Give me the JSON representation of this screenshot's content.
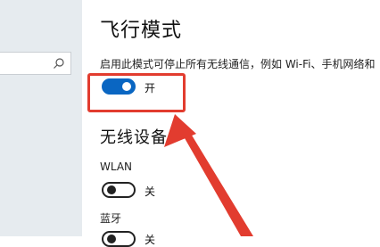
{
  "sidebar": {
    "search": {
      "placeholder": "",
      "icon": "search-icon"
    }
  },
  "main": {
    "title": "飞行模式",
    "description": "启用此模式可停止所有无线通信，例如 Wi-Fi、手机网络和",
    "airplane_toggle": {
      "state": "开",
      "on": true
    },
    "wireless_section_title": "无线设备",
    "devices": [
      {
        "name": "WLAN",
        "state": "关",
        "on": false
      },
      {
        "name": "蓝牙",
        "state": "关",
        "on": false
      }
    ]
  },
  "annotation": {
    "highlight_color": "#e23c2f",
    "arrow_color": "#e23c2f"
  },
  "colors": {
    "accent": "#0a66c2",
    "sidebar_bg": "#e6ebef"
  }
}
